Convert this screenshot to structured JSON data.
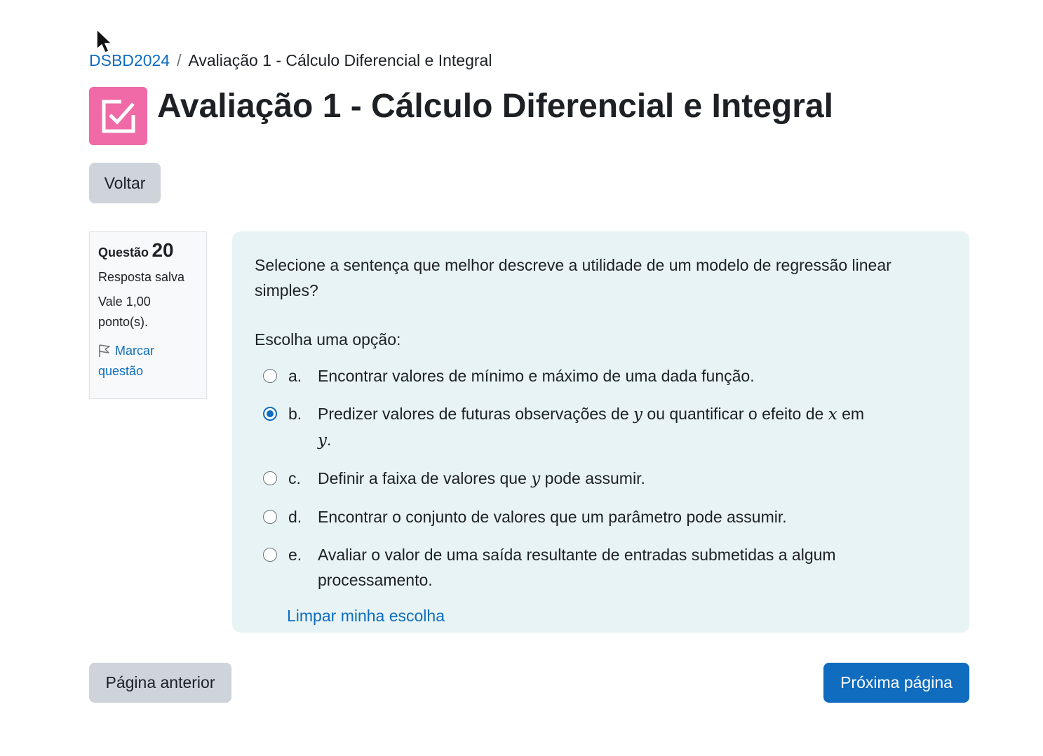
{
  "colors": {
    "accent": "#0f6cbf",
    "activity_icon_bg": "#ef6aa7",
    "question_bg": "#e7f3f5",
    "secondary_btn": "#ced4da"
  },
  "breadcrumb": {
    "course": "DSBD2024",
    "separator": "/",
    "current": "Avaliação 1 - Cálculo Diferencial e Integral"
  },
  "header": {
    "icon": "quiz-checkbox-icon",
    "title": "Avaliação 1 - Cálculo Diferencial e Integral"
  },
  "back_button": "Voltar",
  "question_info": {
    "label": "Questão",
    "number": "20",
    "state": "Resposta salva",
    "grade": "Vale 1,00 ponto(s).",
    "flag_label": "Marcar questão",
    "flag_icon": "flag-icon"
  },
  "question": {
    "text": "Selecione a sentença que melhor descreve a utilidade de um modelo de regressão linear simples?",
    "prompt": "Escolha uma opção:",
    "options": [
      {
        "letter": "a.",
        "text": "Encontrar valores de mínimo e máximo de uma dada função.",
        "selected": false
      },
      {
        "letter": "b.",
        "text_1": "Predizer valores de futuras observações de",
        "var_1": "y",
        "text_2": "ou quantificar o efeito de",
        "var_2": "x",
        "text_3": "em",
        "var_3": "y",
        "text_4": ".",
        "selected": true
      },
      {
        "letter": "c.",
        "text_1": "Definir a faixa de valores que",
        "var_1": "y",
        "text_2": "pode assumir.",
        "selected": false
      },
      {
        "letter": "d.",
        "text": "Encontrar o conjunto de valores que um parâmetro pode assumir.",
        "selected": false
      },
      {
        "letter": "e.",
        "text": "Avaliar o valor de uma saída resultante de entradas submetidas a algum processamento.",
        "selected": false
      }
    ],
    "clear_label": "Limpar minha escolha"
  },
  "navigation": {
    "previous": "Página anterior",
    "next": "Próxima página"
  }
}
